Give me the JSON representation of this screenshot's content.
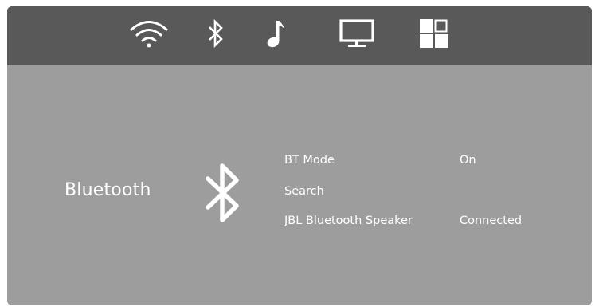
{
  "topbar": {
    "tabs": [
      {
        "id": "wifi",
        "icon": "wifi-icon"
      },
      {
        "id": "bluetooth",
        "icon": "bluetooth-icon",
        "selected": true
      },
      {
        "id": "music",
        "icon": "music-note-icon"
      },
      {
        "id": "display",
        "icon": "monitor-icon"
      },
      {
        "id": "apps",
        "icon": "grid-icon"
      }
    ]
  },
  "panel": {
    "title": "Bluetooth",
    "icon": "bluetooth-icon",
    "options": [
      {
        "label": "BT Mode",
        "value": "On"
      },
      {
        "label": "Search",
        "value": ""
      },
      {
        "label": "JBL Bluetooth Speaker",
        "value": "Connected"
      }
    ]
  },
  "colors": {
    "topbar": "#595959",
    "panel": "#9d9d9d",
    "text": "#ffffff"
  }
}
